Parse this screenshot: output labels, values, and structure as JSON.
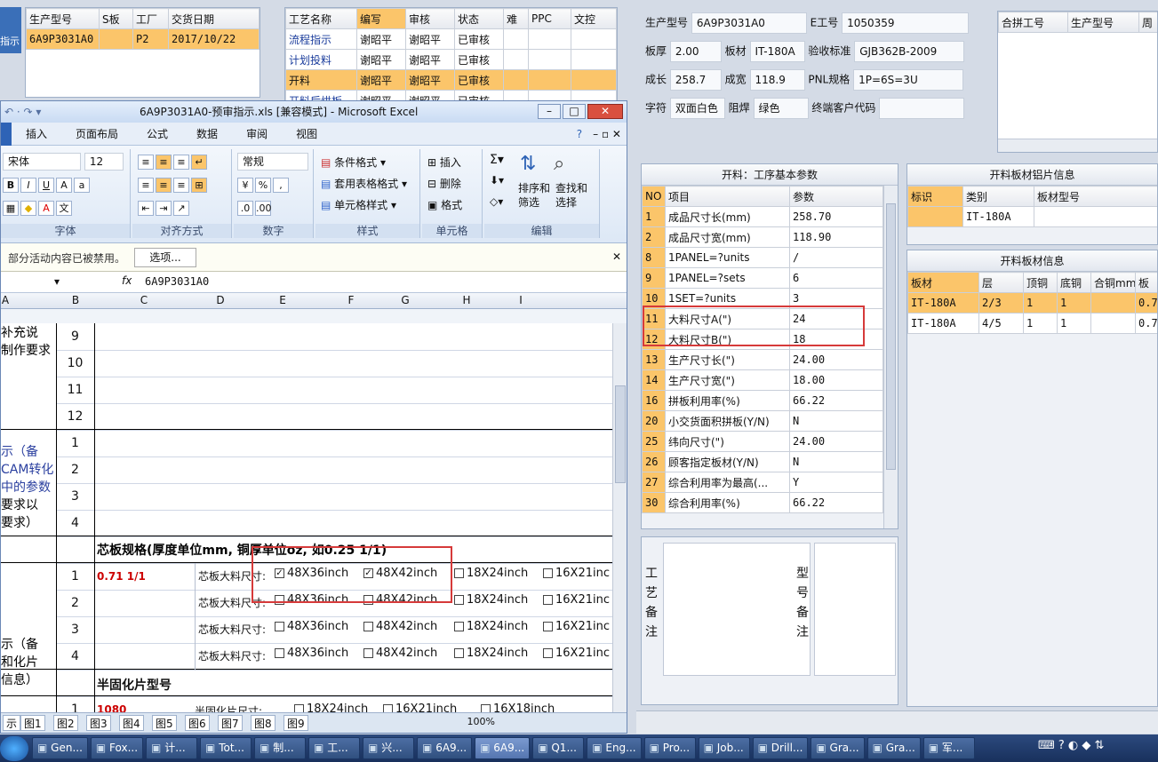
{
  "top_left_grid": {
    "headers": [
      "生产型号",
      "S板",
      "工厂",
      "交货日期"
    ],
    "row": [
      "6A9P3031A0",
      "",
      "P2",
      "2017/10/22"
    ]
  },
  "left_stub": {
    "label": "指示"
  },
  "process_grid": {
    "headers": [
      "工艺名称",
      "编写",
      "审核",
      "状态",
      "难",
      "PPC",
      "文控"
    ],
    "rows": [
      [
        "流程指示",
        "谢昭平",
        "谢昭平",
        "已审核"
      ],
      [
        "计划投料",
        "谢昭平",
        "谢昭平",
        "已审核"
      ],
      [
        "开料",
        "谢昭平",
        "谢昭平",
        "已审核"
      ],
      [
        "开料后烘板",
        "谢昭平",
        "谢昭平",
        "已审核"
      ]
    ]
  },
  "info": {
    "model_label": "生产型号",
    "model": "6A9P3031A0",
    "eno_label": "E工号",
    "eno": "1050359",
    "thickness_label": "板厚",
    "thickness": "2.00",
    "material_label": "板材",
    "material": "IT-180A",
    "std_label": "验收标准",
    "std": "GJB362B-2009",
    "len_label": "成长",
    "len": "258.7",
    "wid_label": "成宽",
    "wid": "118.9",
    "pnl_label": "PNL规格",
    "pnl": "1P=6S=3U",
    "char_label": "字符",
    "char": "双面白色",
    "mask_label": "阻焊",
    "mask": "绿色",
    "cust_label": "终端客户代码",
    "cust": ""
  },
  "combine_grid": {
    "headers": [
      "合拼工号",
      "生产型号",
      "周"
    ]
  },
  "params": {
    "title": "开料：工序基本参数",
    "headers": [
      "NO",
      "项目",
      "参数"
    ],
    "rows": [
      [
        "1",
        "成品尺寸长(mm)",
        "258.70"
      ],
      [
        "2",
        "成品尺寸宽(mm)",
        "118.90"
      ],
      [
        "8",
        "1PANEL=?units",
        "/"
      ],
      [
        "9",
        "1PANEL=?sets",
        "6"
      ],
      [
        "10",
        "1SET=?units",
        "3"
      ],
      [
        "11",
        "大料尺寸A(\")",
        "24"
      ],
      [
        "12",
        "大料尺寸B(\")",
        "18"
      ],
      [
        "13",
        "生产尺寸长(\")",
        "24.00"
      ],
      [
        "14",
        "生产尺寸宽(\")",
        "18.00"
      ],
      [
        "16",
        "拼板利用率(%)",
        "66.22"
      ],
      [
        "20",
        "小交货面积拼板(Y/N)",
        "N"
      ],
      [
        "25",
        "纬向尺寸(\")",
        "24.00"
      ],
      [
        "26",
        "顾客指定板材(Y/N)",
        "N"
      ],
      [
        "27",
        "综合利用率为最高(...",
        "Y"
      ],
      [
        "30",
        "综合利用率(%)",
        "66.22"
      ]
    ]
  },
  "alu": {
    "title": "开料板材铝片信息",
    "headers": [
      "标识",
      "类别",
      "板材型号"
    ],
    "row": [
      "",
      "IT-180A",
      ""
    ]
  },
  "board": {
    "title": "开料板材信息",
    "headers": [
      "板材",
      "层",
      "顶铜",
      "底铜",
      "合铜mm",
      "板"
    ],
    "rows": [
      [
        "IT-180A",
        "2/3",
        "1",
        "1",
        "",
        "0.7"
      ],
      [
        "IT-180A",
        "4/5",
        "1",
        "1",
        "",
        "0.7"
      ]
    ]
  },
  "remarks": {
    "process": "工艺备注",
    "model": "型号备注"
  },
  "excel": {
    "title": "6A9P3031A0-预审指示.xls  [兼容模式] - Microsoft Excel",
    "menus": [
      "插入",
      "页面布局",
      "公式",
      "数据",
      "审阅",
      "视图"
    ],
    "font": "宋体",
    "size": "12",
    "numfmt": "常规",
    "groups": [
      "字体",
      "对齐方式",
      "数字",
      "样式",
      "单元格",
      "编辑"
    ],
    "cond": "条件格式",
    "tblfmt": "套用表格格式",
    "cellstyle": "单元格样式",
    "ins": "插入",
    "del": "删除",
    "fmt": "格式",
    "sort": "排序和筛选",
    "find": "查找和选择",
    "security": "部分活动内容已被禁用。",
    "options": "选项...",
    "formula": "6A9P3031A0",
    "fx": "fx",
    "cols": [
      "A",
      "B",
      "C",
      "D",
      "E",
      "F",
      "G",
      "H",
      "I"
    ],
    "a_texts": [
      "补充说",
      "制作要求",
      "示（备",
      "CAM转化",
      "中的参数",
      "要求以",
      "要求）",
      "示（备",
      "和化片",
      "信息）"
    ],
    "row_nums": [
      "9",
      "10",
      "11",
      "12",
      "1",
      "2",
      "3",
      "4",
      "",
      "1",
      "2",
      "3",
      "4",
      "",
      "1"
    ],
    "core_title": "芯板规格(厚度单位mm, 铜厚单位oz, 如0.25 1/1)",
    "core_val": "0.71 1/1",
    "size_label": "芯板大料尺寸:",
    "opts": [
      "48X36inch",
      "48X42inch",
      "18X24inch",
      "16X21inc"
    ],
    "prepreg_title": "半固化片型号",
    "prepreg_val": "1080",
    "prepreg_label": "半固化片尺寸:",
    "pp_opts": [
      "18X24inch",
      "16X21inch",
      "16X18inch"
    ],
    "tabs": [
      "示",
      "图1",
      "图2",
      "图3",
      "图4",
      "图5",
      "图6",
      "图7",
      "图8",
      "图9"
    ],
    "zoom": "100%"
  },
  "taskbar": [
    "Gen...",
    "Fox...",
    "计...",
    "Tot...",
    "制...",
    "工...",
    "兴...",
    "6A9...",
    "6A9...",
    "Q1...",
    "Eng...",
    "Pro...",
    "Job...",
    "Drill...",
    "Gra...",
    "Gra...",
    "军..."
  ]
}
